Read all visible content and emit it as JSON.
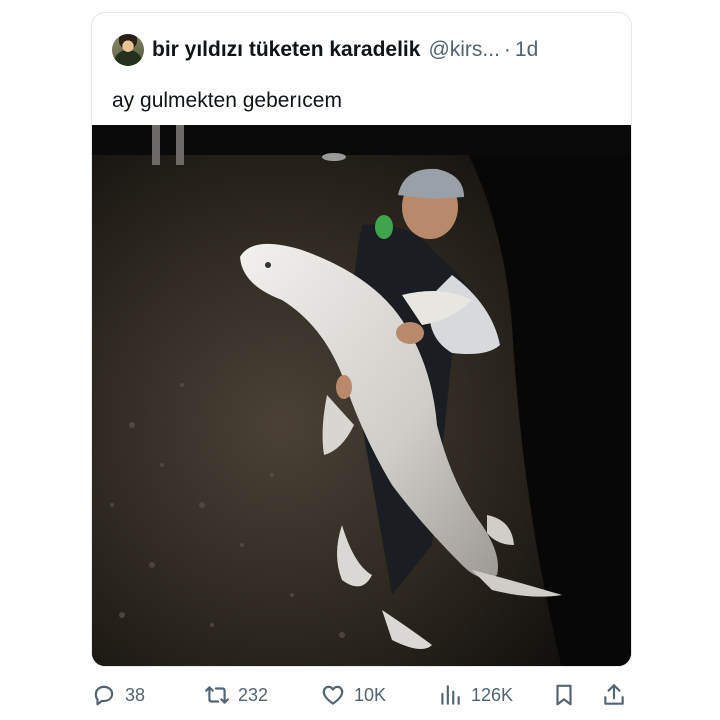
{
  "tweet": {
    "author_name": "bir yıldızı tüketen karadelik",
    "author_handle": "@kirs...",
    "separator": "·",
    "time": "1d",
    "text": "ay gulmekten geberıcem"
  },
  "actions": {
    "replies": "38",
    "retweets": "232",
    "likes": "10K",
    "views": "126K"
  },
  "icons": [
    "reply-icon",
    "retweet-icon",
    "like-icon",
    "views-icon",
    "bookmark-icon",
    "share-icon"
  ],
  "colors": {
    "text": "#0f1419",
    "secondary": "#536471",
    "border": "#e6e9eb"
  }
}
